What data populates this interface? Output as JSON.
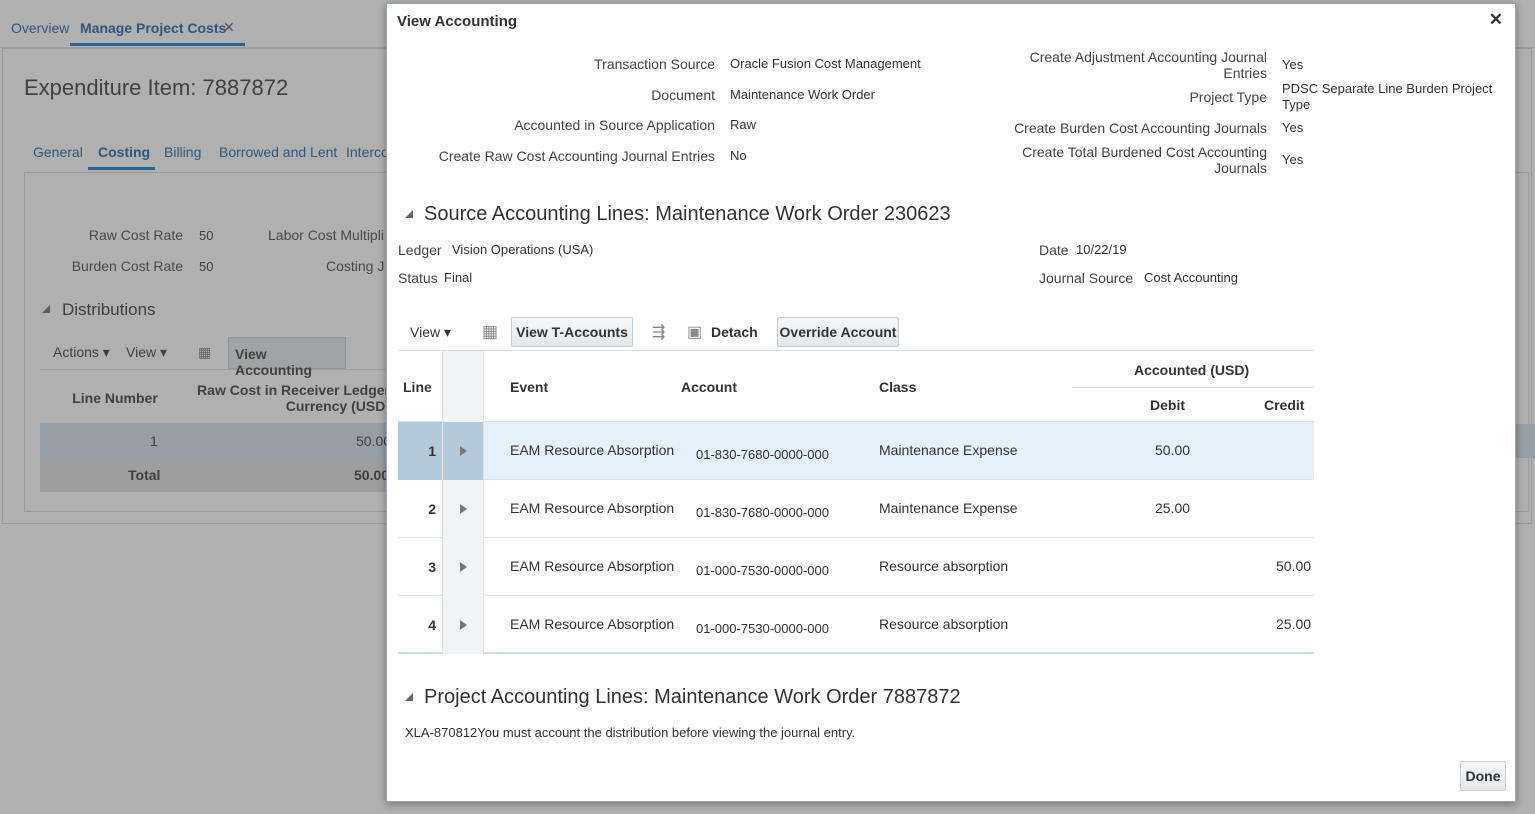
{
  "background": {
    "tabs": {
      "overview": "Overview",
      "manage": "Manage Project Costs",
      "close": "✕"
    },
    "title": "Expenditure Item: 7887872",
    "subtabs": [
      "General",
      "Costing",
      "Billing",
      "Borrowed and Lent",
      "Interco"
    ],
    "fields": {
      "raw_cost_rate_label": "Raw Cost Rate",
      "raw_cost_rate_value": "50",
      "burden_cost_rate_label": "Burden Cost Rate",
      "burden_cost_rate_value": "50",
      "labor_cost_mult_label": "Labor Cost Multipli",
      "costing_label": "Costing J"
    },
    "distributions": {
      "heading": "Distributions",
      "actions": "Actions",
      "view": "View",
      "view_accounting": "View Accounting",
      "col_line_number": "Line Number",
      "col_raw_cost": "Raw Cost in Receiver Ledger Currency (USD)",
      "row1_line": "1",
      "row1_value": "50.00",
      "total_label": "Total",
      "total_value": "50.00"
    }
  },
  "dialog": {
    "title": "View Accounting",
    "close": "✕",
    "fields_left": [
      {
        "label": "Transaction Source",
        "value": "Oracle Fusion Cost Management"
      },
      {
        "label": "Document",
        "value": "Maintenance Work Order"
      },
      {
        "label": "Accounted in Source Application",
        "value": "Raw"
      },
      {
        "label": "Create Raw Cost Accounting Journal Entries",
        "value": "No"
      }
    ],
    "fields_right": [
      {
        "label_l1": "Create Adjustment Accounting Journal",
        "label_l2": "Entries",
        "value": "Yes"
      },
      {
        "label_l1": "Project Type",
        "label_l2": "",
        "value_l1": "PDSC Separate Line Burden Project",
        "value_l2": "Type"
      },
      {
        "label_l1": "Create Burden Cost Accounting Journals",
        "label_l2": "",
        "value": "Yes"
      },
      {
        "label_l1": "Create Total Burdened Cost Accounting",
        "label_l2": "Journals",
        "value": "Yes"
      }
    ],
    "source_section": {
      "heading": "Source Accounting Lines: Maintenance Work Order 230623",
      "ledger_label": "Ledger",
      "ledger_value": "Vision Operations (USA)",
      "status_label": "Status",
      "status_value": "Final",
      "date_label": "Date",
      "date_value": "10/22/19",
      "journal_source_label": "Journal Source",
      "journal_source_value": "Cost Accounting"
    },
    "toolbar": {
      "view": "View",
      "view_t_accounts": "View T-Accounts",
      "detach": "Detach",
      "override_account": "Override Account"
    },
    "table": {
      "col_line": "Line",
      "col_event": "Event",
      "col_account": "Account",
      "col_class": "Class",
      "col_accounted": "Accounted (USD)",
      "col_debit": "Debit",
      "col_credit": "Credit",
      "rows": [
        {
          "line": "1",
          "event": "EAM Resource Absorption",
          "account": "01-830-7680-0000-000",
          "class": "Maintenance Expense",
          "debit": "50.00",
          "credit": ""
        },
        {
          "line": "2",
          "event": "EAM Resource Absorption",
          "account": "01-830-7680-0000-000",
          "class": "Maintenance Expense",
          "debit": "25.00",
          "credit": ""
        },
        {
          "line": "3",
          "event": "EAM Resource Absorption",
          "account": "01-000-7530-0000-000",
          "class": "Resource absorption",
          "debit": "",
          "credit": "50.00"
        },
        {
          "line": "4",
          "event": "EAM Resource Absorption",
          "account": "01-000-7530-0000-000",
          "class": "Resource absorption",
          "debit": "",
          "credit": "25.00"
        }
      ]
    },
    "project_section": {
      "heading": "Project Accounting Lines: Maintenance Work Order 7887872",
      "message": "XLA-870812You must account the distribution before viewing the journal entry."
    },
    "done": "Done"
  }
}
